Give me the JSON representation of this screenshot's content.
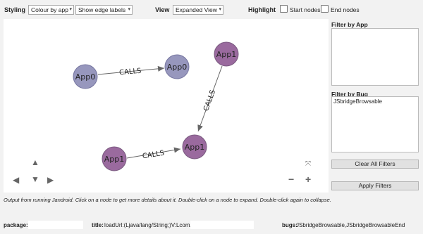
{
  "toolbar": {
    "styling_label": "Styling",
    "colour_select": "Colour by app",
    "edge_select": "Show edge labels",
    "view_label": "View",
    "view_select": "Expanded View",
    "highlight_label": "Highlight",
    "start_nodes_label": "Start nodes",
    "end_nodes_label": "End nodes"
  },
  "graph": {
    "nodes": [
      {
        "label": "App0",
        "color": "#9797bd"
      },
      {
        "label": "App0",
        "color": "#9797bd"
      },
      {
        "label": "App1",
        "color": "#9a6a9e"
      },
      {
        "label": "App1",
        "color": "#9a6a9e"
      },
      {
        "label": "App1",
        "color": "#9a6a9e"
      }
    ],
    "edge_label": "CALLS",
    "nav": {
      "up": "▲",
      "left": "◀",
      "down": "▼",
      "right": "▶",
      "fit": "⤧",
      "zoom_out": "−",
      "zoom_in": "+"
    }
  },
  "sidebar": {
    "filter_app_title": "Filter by App",
    "filter_bug_title": "Filter by Bug",
    "bug_items": [
      "JSbridgeBrowsable"
    ],
    "clear_button": "Clear All Filters",
    "apply_button": "Apply Filters"
  },
  "info_text": "Output from running Jandroid. Click on a node to get more details about it. Double-click on a node to expand. Double-click again to collapse.",
  "bottom": {
    "package_label": "package:",
    "package_value": "",
    "title_label": "title:",
    "title_value": "loadUrl:(Ljava/lang/String;)V:Lcom/",
    "bugs_label": "bugs:",
    "bugs_value": "JSbridgeBrowsable,JSbridgeBrowsableEnd"
  },
  "colors": {
    "edge": "#666666",
    "node_border": "#7a5a80"
  }
}
